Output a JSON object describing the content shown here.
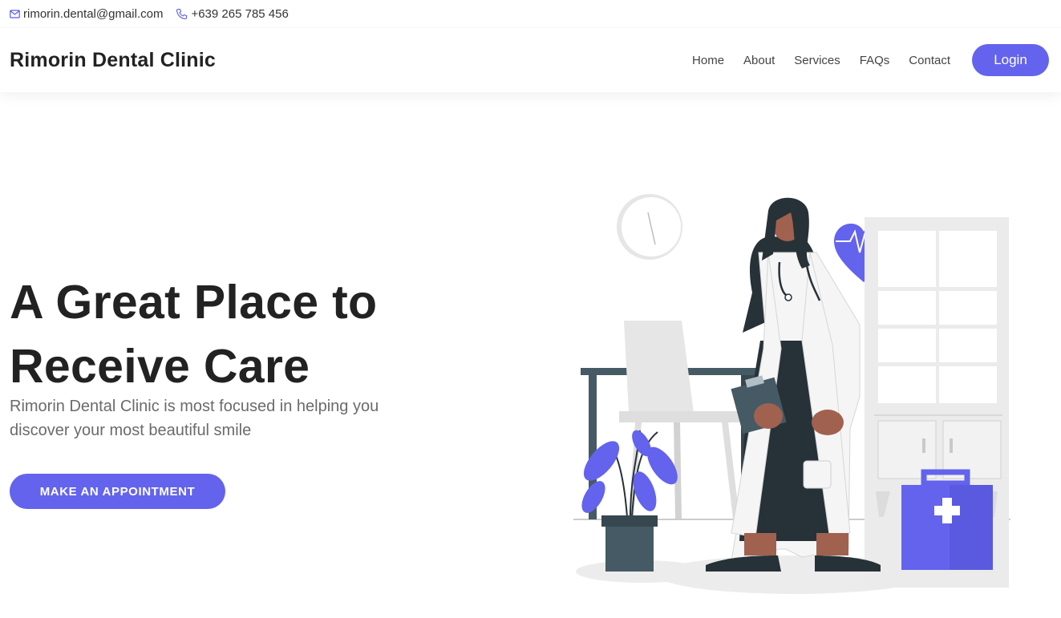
{
  "topbar": {
    "email": "rimorin.dental@gmail.com",
    "phone": "+639 265 785 456",
    "email_icon": "envelope-icon",
    "phone_icon": "phone-icon"
  },
  "navbar": {
    "brand": "Rimorin Dental Clinic",
    "links": [
      "Home",
      "About",
      "Services",
      "FAQs",
      "Contact"
    ],
    "login_label": "Login"
  },
  "hero": {
    "title_line1": "A Great Place to",
    "title_line2": "Receive Care",
    "subtitle_line1": "Rimorin Dental Clinic is most focused in helping you",
    "subtitle_line2": "discover your most beautiful smile",
    "cta_label": "MAKE AN APPOINTMENT",
    "illustration": "doctor-illustration"
  },
  "colors": {
    "accent": "#6363ee",
    "heading": "#222222",
    "body_text": "#6b6b6b"
  }
}
